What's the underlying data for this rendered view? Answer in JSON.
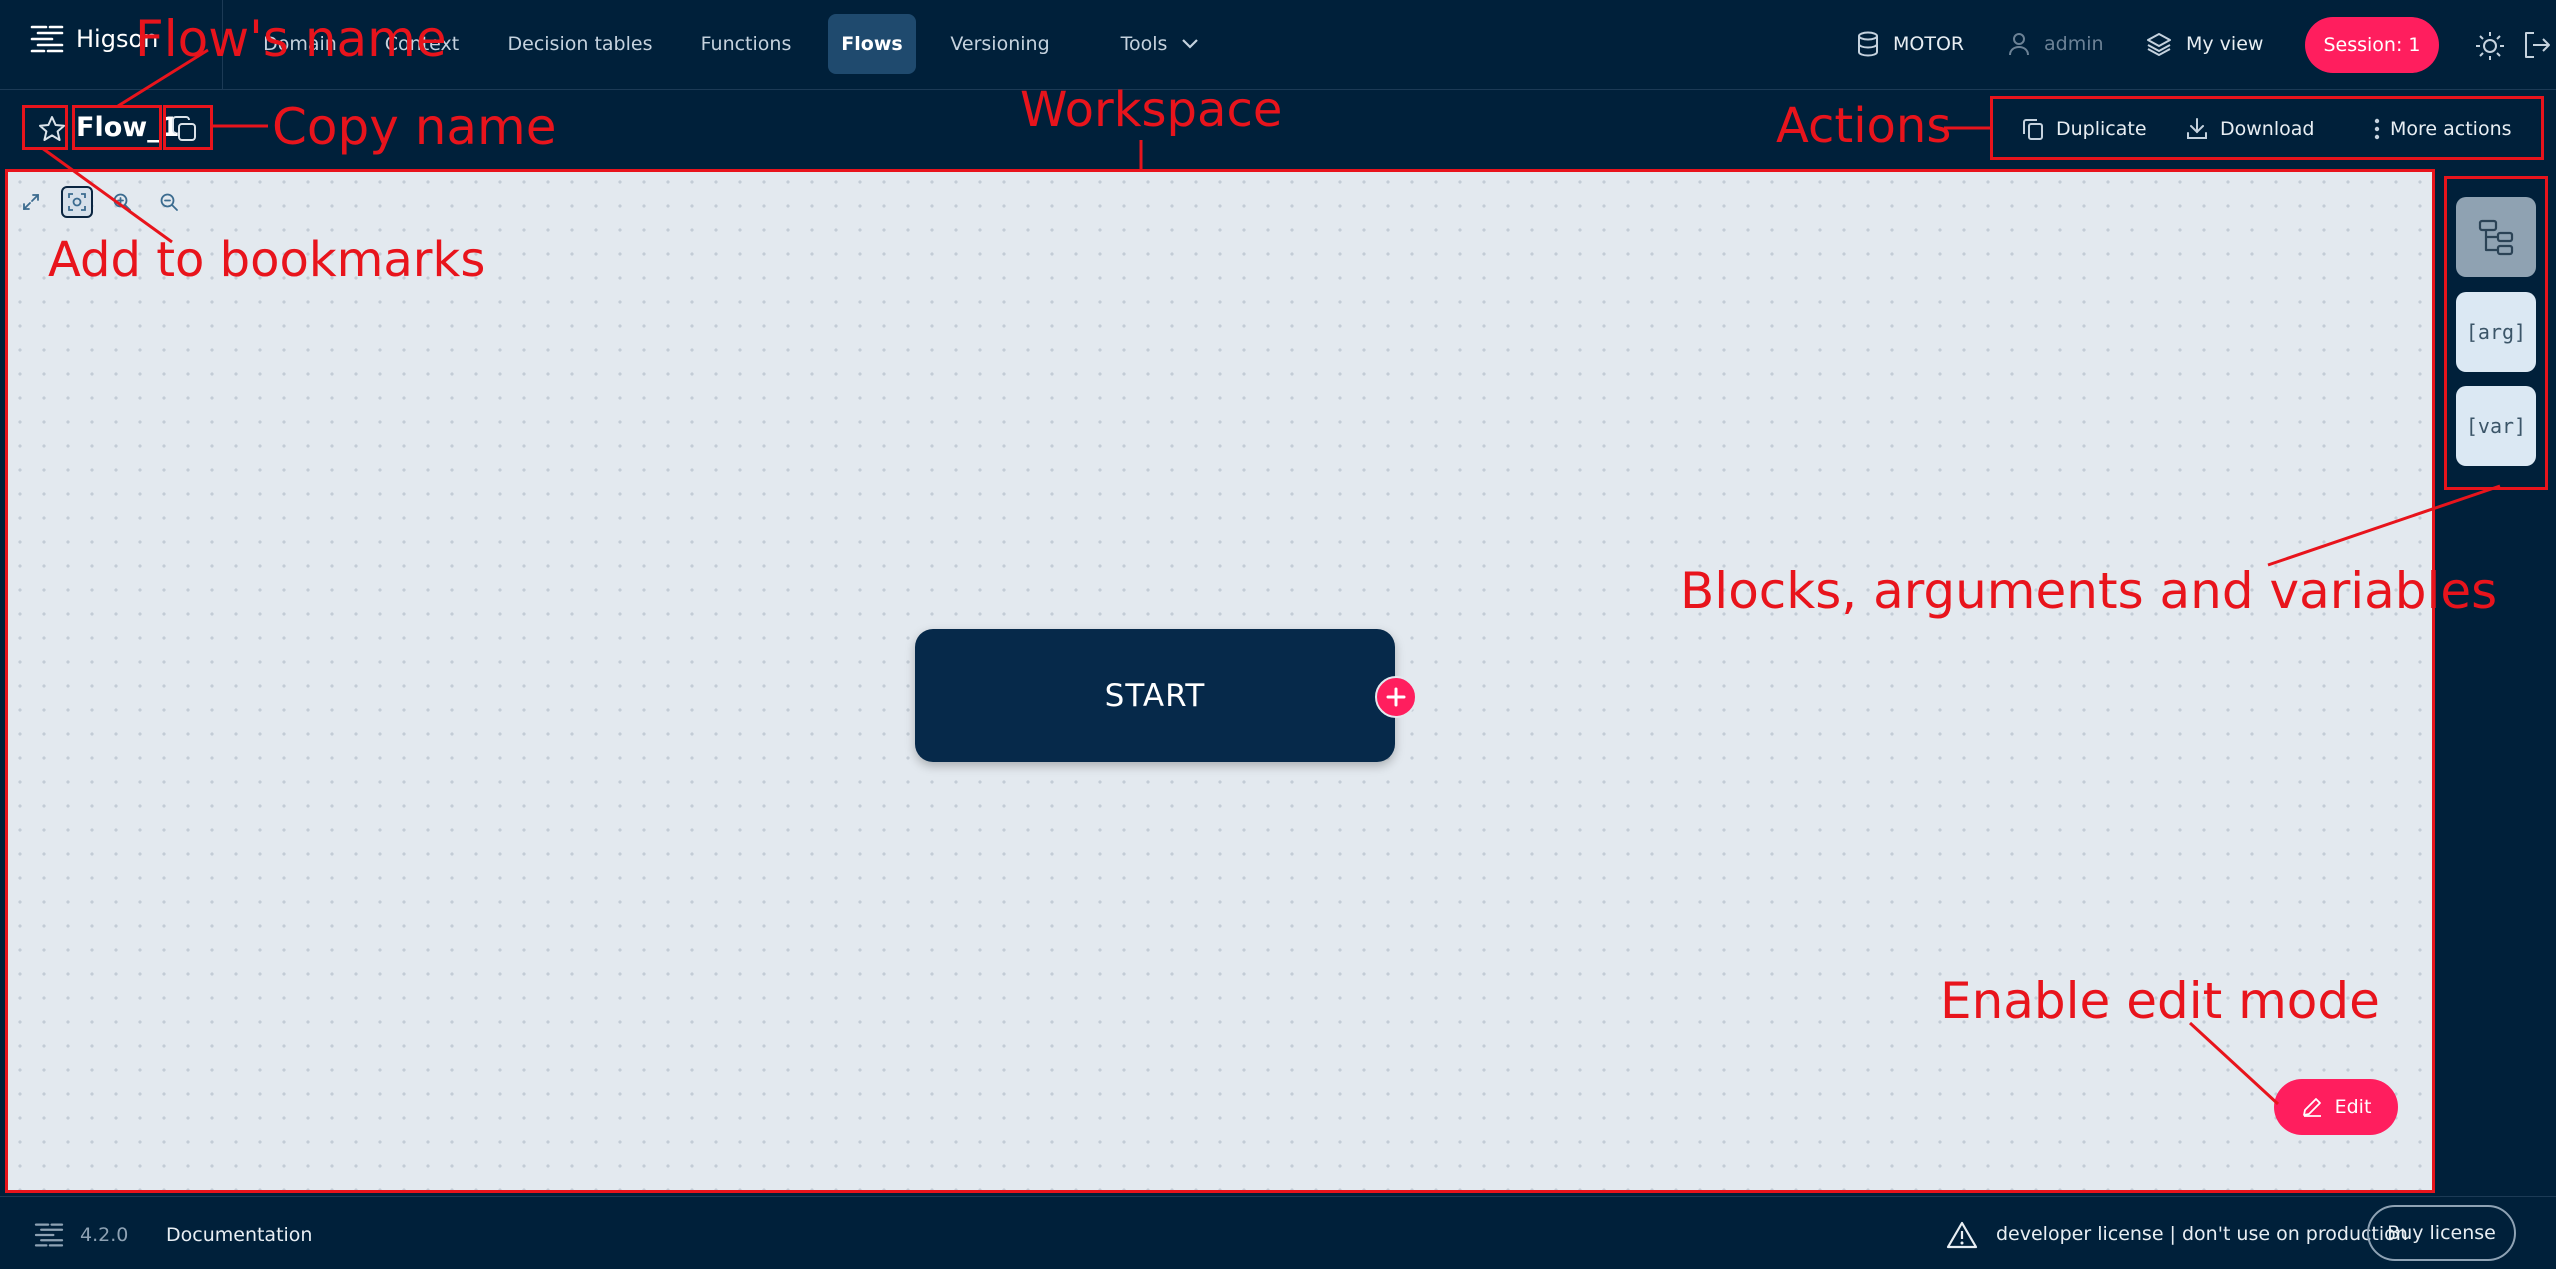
{
  "app": {
    "name": "Higson"
  },
  "nav": {
    "items": [
      "Domain",
      "Context",
      "Decision tables",
      "Functions",
      "Flows",
      "Versioning",
      "Tools"
    ],
    "active": "Flows"
  },
  "header_right": {
    "environment": "MOTOR",
    "user": "admin",
    "view": "My view",
    "session": "Session: 1"
  },
  "flow": {
    "name": "Flow_1"
  },
  "actions": {
    "duplicate": "Duplicate",
    "download": "Download",
    "more": "More actions"
  },
  "canvas": {
    "start_node": "START",
    "edit_button": "Edit"
  },
  "side_panel": {
    "items": [
      "blocks",
      "[arg]",
      "[var]"
    ]
  },
  "footer": {
    "version": "4.2.0",
    "documentation": "Documentation",
    "license_notice": "developer license | don't use on production",
    "buy": "Buy license"
  },
  "annotations": {
    "flow_name": "Flow's name",
    "copy_name": "Copy name",
    "workspace": "Workspace",
    "actions": "Actions",
    "bookmarks": "Add to bookmarks",
    "side": "Blocks, arguments and variables",
    "edit": "Enable edit mode"
  },
  "colors": {
    "accent": "#ff1e5e",
    "background": "#00203a",
    "canvas": "#e3e9ef",
    "annotation": "#e8141c"
  }
}
